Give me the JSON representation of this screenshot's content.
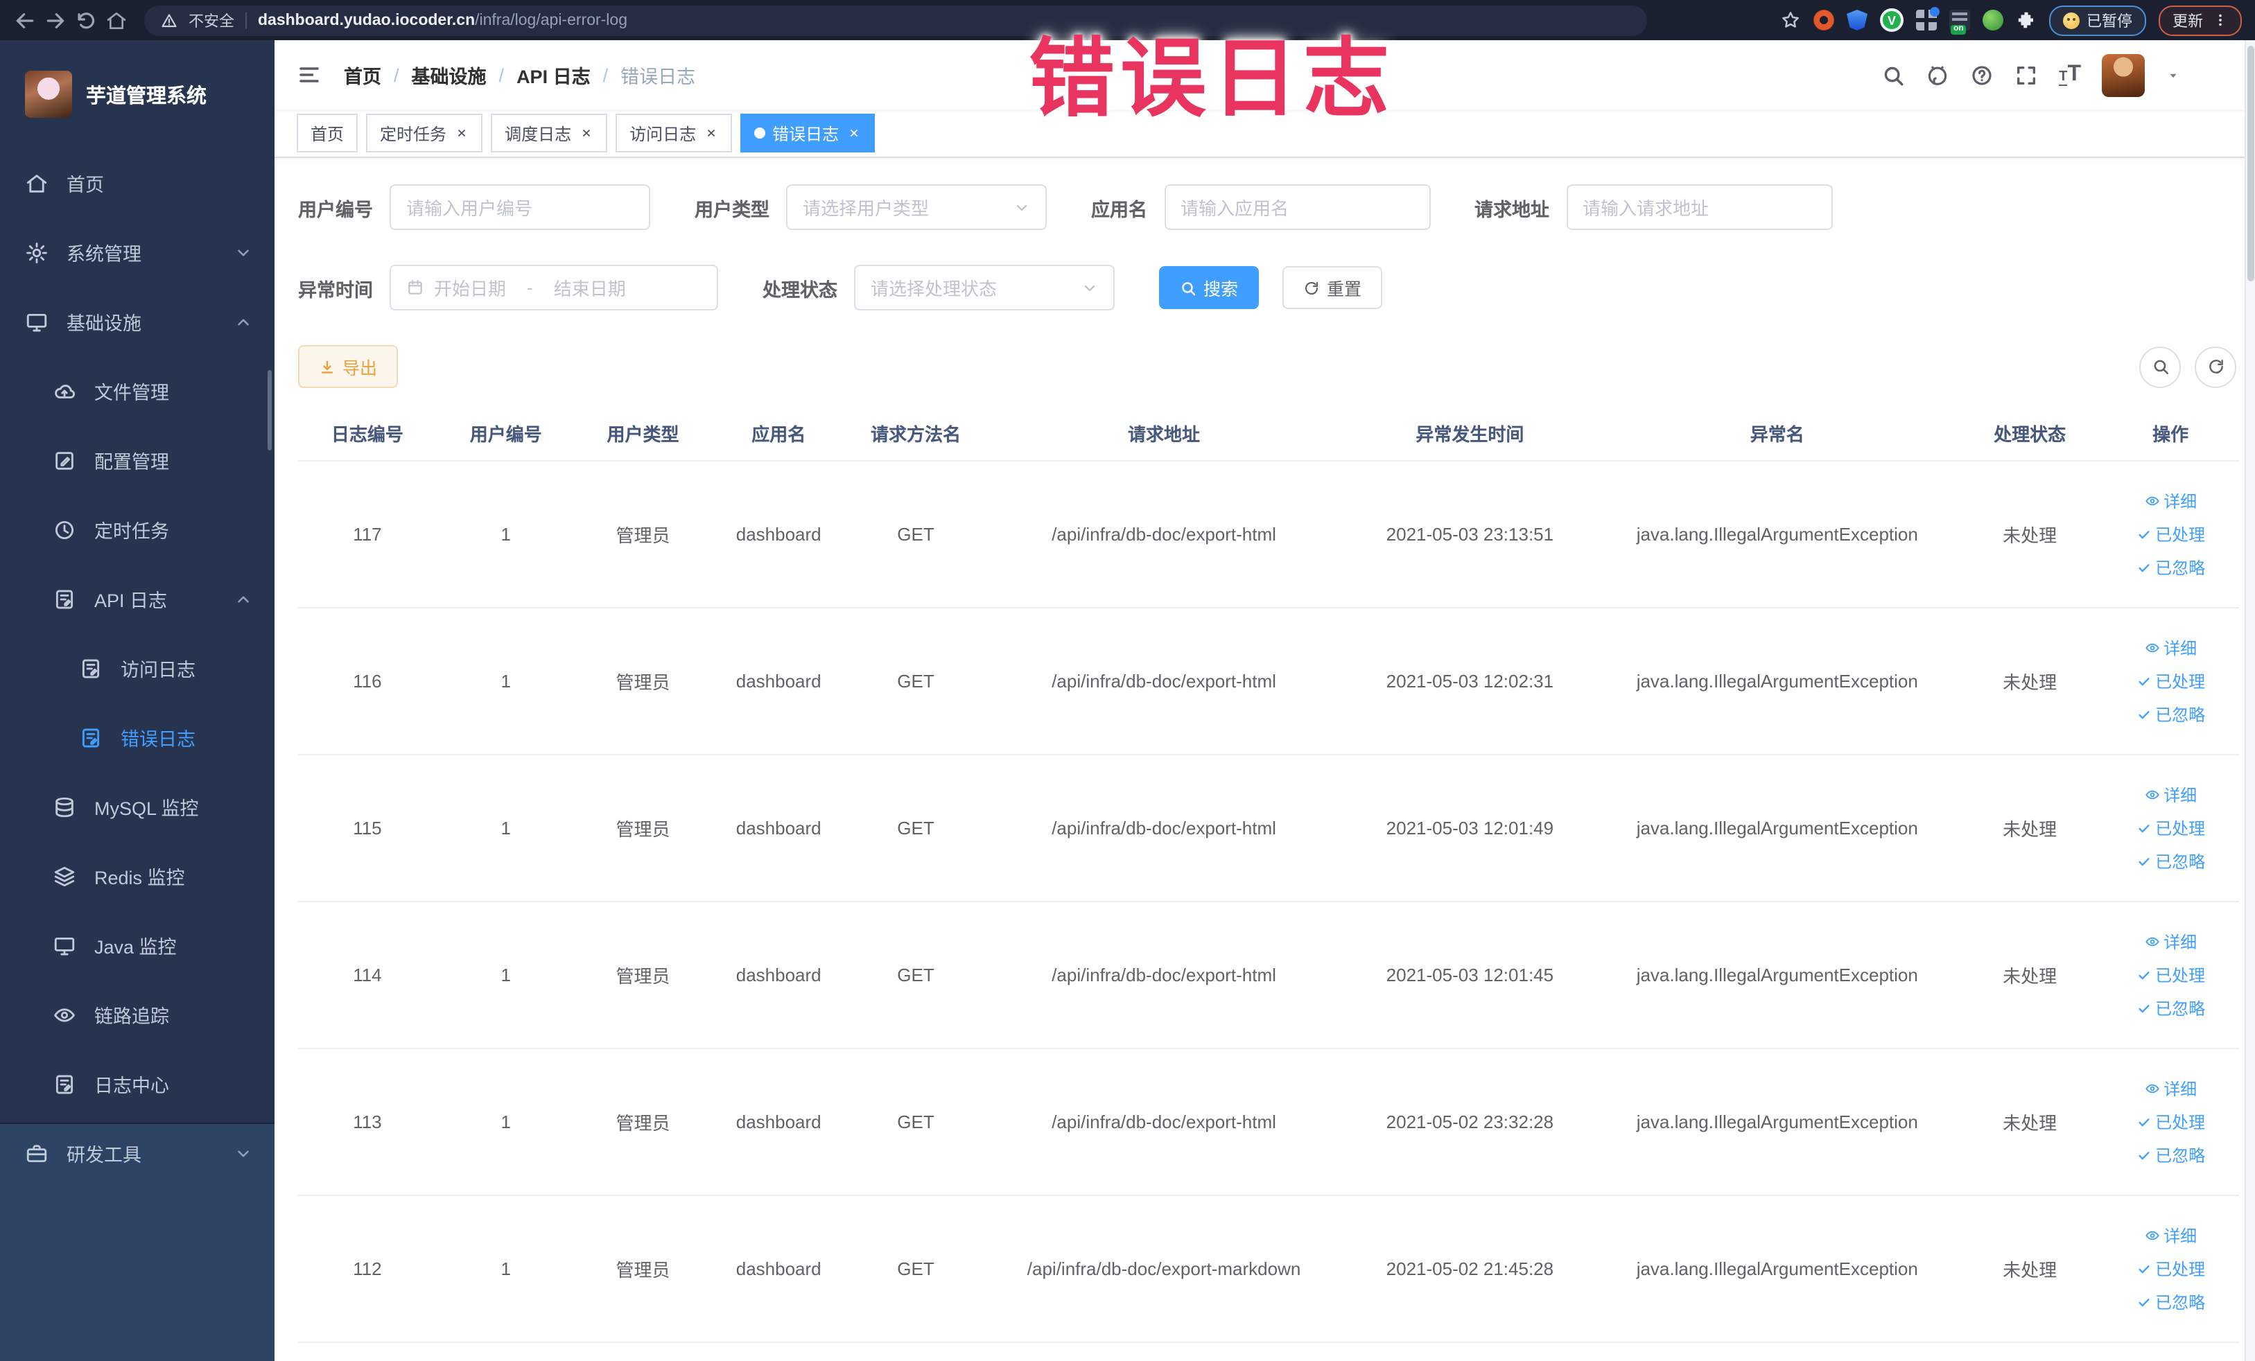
{
  "browser": {
    "security_label": "不安全",
    "url_host": "dashboard.yudao.iocoder.cn",
    "url_path": "/infra/log/api-error-log",
    "paused_label": "已暂停",
    "update_label": "更新"
  },
  "overlay": {
    "text": "错误日志",
    "color": "#e8345e"
  },
  "sidebar": {
    "title": "芋道管理系统",
    "items": [
      {
        "label": "首页",
        "icon": "home-icon",
        "indent": 0,
        "arrow": "",
        "active": false,
        "light": false
      },
      {
        "label": "系统管理",
        "icon": "gear-icon",
        "indent": 0,
        "arrow": "down",
        "active": false,
        "light": false
      },
      {
        "label": "基础设施",
        "icon": "monitor-icon",
        "indent": 0,
        "arrow": "up",
        "active": false,
        "light": false
      },
      {
        "label": "文件管理",
        "icon": "cloud-upload-icon",
        "indent": 1,
        "arrow": "",
        "active": false,
        "light": false
      },
      {
        "label": "配置管理",
        "icon": "edit-icon",
        "indent": 1,
        "arrow": "",
        "active": false,
        "light": false
      },
      {
        "label": "定时任务",
        "icon": "clock-icon",
        "indent": 1,
        "arrow": "",
        "active": false,
        "light": false
      },
      {
        "label": "API 日志",
        "icon": "log-icon",
        "indent": 1,
        "arrow": "up",
        "active": false,
        "light": false
      },
      {
        "label": "访问日志",
        "icon": "log-icon",
        "indent": 2,
        "arrow": "",
        "active": false,
        "light": false
      },
      {
        "label": "错误日志",
        "icon": "log-icon",
        "indent": 2,
        "arrow": "",
        "active": true,
        "light": false
      },
      {
        "label": "MySQL 监控",
        "icon": "database-icon",
        "indent": 1,
        "arrow": "",
        "active": false,
        "light": false
      },
      {
        "label": "Redis 监控",
        "icon": "stack-icon",
        "indent": 1,
        "arrow": "",
        "active": false,
        "light": false
      },
      {
        "label": "Java 监控",
        "icon": "monitor-icon",
        "indent": 1,
        "arrow": "",
        "active": false,
        "light": false
      },
      {
        "label": "链路追踪",
        "icon": "eye-icon",
        "indent": 1,
        "arrow": "",
        "active": false,
        "light": false
      },
      {
        "label": "日志中心",
        "icon": "log-icon",
        "indent": 1,
        "arrow": "",
        "active": false,
        "light": false
      },
      {
        "label": "研发工具",
        "icon": "briefcase-icon",
        "indent": 0,
        "arrow": "down",
        "active": false,
        "light": true
      }
    ]
  },
  "navbar": {
    "breadcrumb": [
      "首页",
      "基础设施",
      "API 日志",
      "错误日志"
    ]
  },
  "tabs": [
    {
      "label": "首页",
      "closable": false,
      "active": false
    },
    {
      "label": "定时任务",
      "closable": true,
      "active": false
    },
    {
      "label": "调度日志",
      "closable": true,
      "active": false
    },
    {
      "label": "访问日志",
      "closable": true,
      "active": false
    },
    {
      "label": "错误日志",
      "closable": true,
      "active": true
    }
  ],
  "filters": {
    "user_id": {
      "label": "用户编号",
      "placeholder": "请输入用户编号"
    },
    "user_type": {
      "label": "用户类型",
      "placeholder": "请选择用户类型"
    },
    "app_name": {
      "label": "应用名",
      "placeholder": "请输入应用名"
    },
    "request_url": {
      "label": "请求地址",
      "placeholder": "请输入请求地址"
    },
    "exception_time": {
      "label": "异常时间",
      "start_placeholder": "开始日期",
      "separator": "-",
      "end_placeholder": "结束日期"
    },
    "process_status": {
      "label": "处理状态",
      "placeholder": "请选择处理状态"
    },
    "search_label": "搜索",
    "reset_label": "重置"
  },
  "toolbar": {
    "export_label": "导出"
  },
  "table": {
    "columns": [
      "日志编号",
      "用户编号",
      "用户类型",
      "应用名",
      "请求方法名",
      "请求地址",
      "异常发生时间",
      "异常名",
      "处理状态",
      "操作"
    ],
    "actions": [
      "详细",
      "已处理",
      "已忽略"
    ],
    "rows": [
      {
        "id": "117",
        "user_id": "1",
        "user_type": "管理员",
        "app": "dashboard",
        "method": "GET",
        "url": "/api/infra/db-doc/export-html",
        "time": "2021-05-03 23:13:51",
        "exception": "java.lang.IllegalArgumentException",
        "status": "未处理"
      },
      {
        "id": "116",
        "user_id": "1",
        "user_type": "管理员",
        "app": "dashboard",
        "method": "GET",
        "url": "/api/infra/db-doc/export-html",
        "time": "2021-05-03 12:02:31",
        "exception": "java.lang.IllegalArgumentException",
        "status": "未处理"
      },
      {
        "id": "115",
        "user_id": "1",
        "user_type": "管理员",
        "app": "dashboard",
        "method": "GET",
        "url": "/api/infra/db-doc/export-html",
        "time": "2021-05-03 12:01:49",
        "exception": "java.lang.IllegalArgumentException",
        "status": "未处理"
      },
      {
        "id": "114",
        "user_id": "1",
        "user_type": "管理员",
        "app": "dashboard",
        "method": "GET",
        "url": "/api/infra/db-doc/export-html",
        "time": "2021-05-03 12:01:45",
        "exception": "java.lang.IllegalArgumentException",
        "status": "未处理"
      },
      {
        "id": "113",
        "user_id": "1",
        "user_type": "管理员",
        "app": "dashboard",
        "method": "GET",
        "url": "/api/infra/db-doc/export-html",
        "time": "2021-05-02 23:32:28",
        "exception": "java.lang.IllegalArgumentException",
        "status": "未处理"
      },
      {
        "id": "112",
        "user_id": "1",
        "user_type": "管理员",
        "app": "dashboard",
        "method": "GET",
        "url": "/api/infra/db-doc/export-markdown",
        "time": "2021-05-02 21:45:28",
        "exception": "java.lang.IllegalArgumentException",
        "status": "未处理"
      }
    ]
  },
  "colors": {
    "accent": "#409eff",
    "warning": "#e6a23c",
    "overlay_red": "#e8345e",
    "sidebar_dark": "#263450",
    "sidebar_light": "#2d4464"
  }
}
